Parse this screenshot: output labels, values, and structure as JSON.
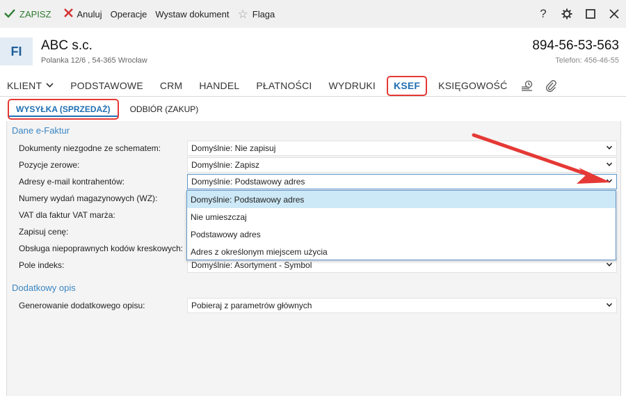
{
  "toolbar": {
    "save": "ZAPISZ",
    "cancel": "Anuluj",
    "operations": "Operacje",
    "issue_document": "Wystaw dokument",
    "flag": "Flaga"
  },
  "window": {
    "help": "?"
  },
  "header": {
    "avatar": "FI",
    "company": "ABC s.c.",
    "address": "Polanka  12/6 , 54-365 Wrocław",
    "nip": "894-56-53-563",
    "phone": "Telefon: 456-46-55"
  },
  "tabs": {
    "client": "KLIENT",
    "basic": "PODSTAWOWE",
    "crm": "CRM",
    "trade": "HANDEL",
    "payments": "PŁATNOŚCI",
    "printouts": "WYDRUKI",
    "ksef": "KSEF",
    "accounting": "KSIĘGOWOŚĆ"
  },
  "subtabs": {
    "sending": "WYSYŁKA (SPRZEDAŻ)",
    "receiving": "ODBIÓR (ZAKUP)"
  },
  "sections": {
    "efaktur": "Dane e-Faktur",
    "extra": "Dodatkowy opis"
  },
  "fields": {
    "noncompliant": {
      "label": "Dokumenty niezgodne ze schematem:",
      "value": "Domyślnie: Nie zapisuj"
    },
    "zero_items": {
      "label": "Pozycje zerowe:",
      "value": "Domyślnie: Zapisz"
    },
    "emails": {
      "label": "Adresy e-mail kontrahentów:",
      "value": "Domyślnie: Podstawowy adres"
    },
    "wz_numbers": {
      "label": "Numery wydań magazynowych (WZ):"
    },
    "vat_margin": {
      "label": "VAT dla faktur VAT marża:"
    },
    "save_price": {
      "label": "Zapisuj cenę:"
    },
    "barcodes": {
      "label": "Obsługa niepoprawnych kodów kreskowych:"
    },
    "index_field": {
      "label": "Pole indeks:",
      "value": "Domyślnie: Asortyment - Symbol"
    },
    "extra_desc": {
      "label": "Generowanie dodatkowego opisu:",
      "value": "Pobieraj z parametrów głównych"
    }
  },
  "dropdown": {
    "options": [
      "Domyślnie: Podstawowy adres",
      "Nie umieszczaj",
      "Podstawowy adres",
      "Adres z określonym miejscem użycia"
    ]
  },
  "colors": {
    "accent": "#1f6fb2",
    "highlight": "#e53935",
    "section": "#3b86c3",
    "selected_option": "#cde8f6"
  }
}
